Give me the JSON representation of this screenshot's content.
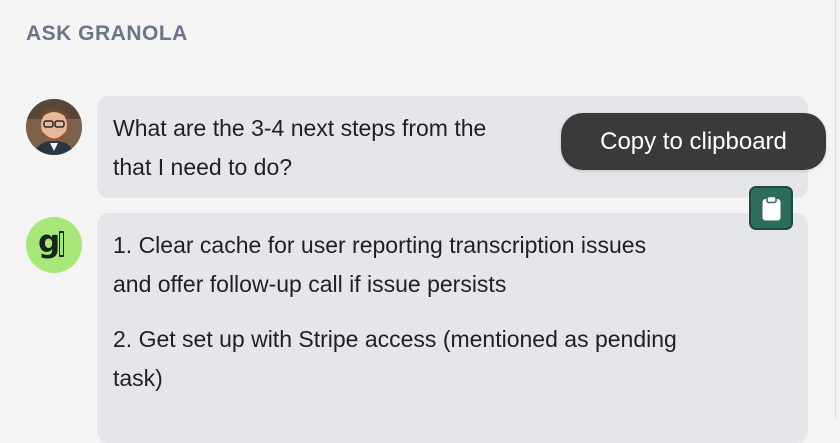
{
  "panel": {
    "title": "ASK GRANOLA"
  },
  "conversation": {
    "question": {
      "line1": "What are the 3-4 next steps from the",
      "line2": "that I need to do?"
    },
    "answer": {
      "steps": [
        {
          "line1": "1. Clear cache for user reporting transcription issues",
          "line2": "and offer follow-up call if issue persists"
        },
        {
          "line1": "2. Get set up with Stripe access (mentioned as pending",
          "line2": "task)"
        }
      ]
    }
  },
  "tooltip": {
    "label": "Copy to clipboard"
  },
  "avatar": {
    "assistant_glyph": "g"
  },
  "icons": {
    "copy": "clipboard-icon",
    "assistant": "granola-logo"
  },
  "colors": {
    "accent_green": "#a8e87a",
    "copy_button": "#2f6b5b",
    "tooltip_bg": "#3a3a3b",
    "title": "#6b7489"
  }
}
